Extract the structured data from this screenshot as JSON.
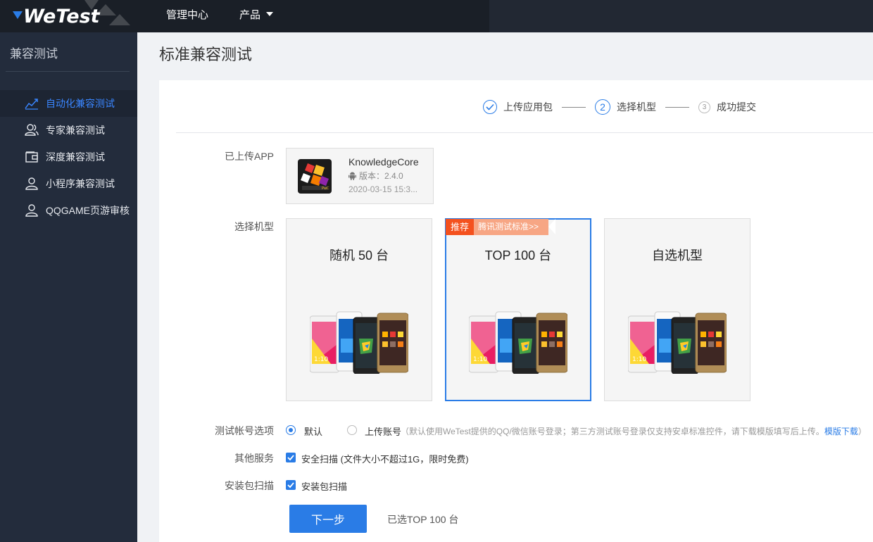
{
  "topbar": {
    "logo_text": "WeTest",
    "nav": [
      {
        "label": "管理中心"
      },
      {
        "label": "产品"
      }
    ]
  },
  "sidebar": {
    "title": "兼容测试",
    "items": [
      {
        "label": "自动化兼容测试",
        "icon": "line-chart-icon",
        "active": true
      },
      {
        "label": "专家兼容测试",
        "icon": "users-icon",
        "active": false
      },
      {
        "label": "深度兼容测试",
        "icon": "wallet-icon",
        "active": false
      },
      {
        "label": "小程序兼容测试",
        "icon": "user-icon",
        "active": false
      },
      {
        "label": "QQGAME页游审核",
        "icon": "user-icon",
        "active": false
      }
    ]
  },
  "page": {
    "title": "标准兼容测试"
  },
  "steps": [
    {
      "label": "上传应用包",
      "state": "done"
    },
    {
      "label": "选择机型",
      "state": "current",
      "number": "2"
    },
    {
      "label": "成功提交",
      "state": "todo",
      "number": "3"
    }
  ],
  "form": {
    "uploaded_app_label": "已上传APP",
    "app": {
      "name": "KnowledgeCore",
      "version": "版本：2.4.0",
      "date": "2020-03-15 15:3..."
    },
    "select_model_label": "选择机型",
    "choices": [
      {
        "title": "随机 50 台",
        "selected": false
      },
      {
        "title": "TOP 100 台",
        "selected": true,
        "badge": "推荐",
        "badge_note": "腾讯测试标准>>"
      },
      {
        "title": "自选机型",
        "selected": false
      }
    ],
    "account_label": "测试帐号选项",
    "account_options": [
      {
        "label": "默认",
        "checked": true
      },
      {
        "label": "上传账号",
        "checked": false
      }
    ],
    "account_hint": "（默认使用WeTest提供的QQ/微信账号登录；第三方测试账号登录仅支持安卓标准控件，请下载模版填写后上传。",
    "account_hint_link": "模版下载",
    "account_hint_end": "）",
    "other_services_label": "其他服务",
    "security_scan": "安全扫描 (文件大小不超过1G，限时免费)",
    "package_scan_label": "安装包扫描",
    "package_scan": "安装包扫描",
    "next_button": "下一步",
    "selected_summary": "已选TOP 100 台"
  },
  "colors": {
    "accent": "#2a7ce6",
    "topbar": "#1a1f27",
    "sidebar": "#232c3c",
    "badge": "#f4511e"
  }
}
